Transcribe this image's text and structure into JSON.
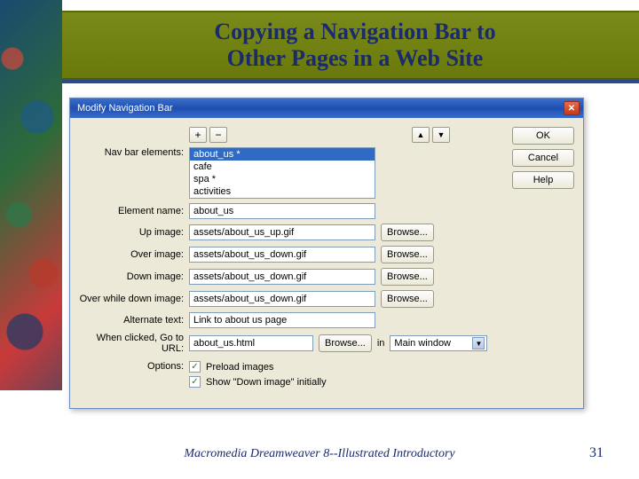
{
  "slide": {
    "title_line1": "Copying a Navigation Bar to",
    "title_line2": "Other Pages in a Web Site",
    "footer": "Macromedia Dreamweaver 8--Illustrated Introductory",
    "page_number": "31"
  },
  "dialog": {
    "title": "Modify Navigation Bar",
    "buttons": {
      "ok": "OK",
      "cancel": "Cancel",
      "help": "Help",
      "browse": "Browse...",
      "close": "✕"
    },
    "toolbar": {
      "plus": "+",
      "minus": "−",
      "up": "▲",
      "down": "▼"
    },
    "labels": {
      "nav_bar_elements": "Nav bar elements:",
      "element_name": "Element name:",
      "up_image": "Up image:",
      "over_image": "Over image:",
      "down_image": "Down image:",
      "over_while_down": "Over while down image:",
      "alternate_text": "Alternate text:",
      "goto_url": "When clicked, Go to URL:",
      "in": "in",
      "options": "Options:"
    },
    "list_items": [
      "about_us *",
      "cafe",
      "spa *",
      "activities"
    ],
    "list_selected_index": 0,
    "fields": {
      "element_name": "about_us",
      "up_image": "assets/about_us_up.gif",
      "over_image": "assets/about_us_down.gif",
      "down_image": "assets/about_us_down.gif",
      "over_while_down": "assets/about_us_down.gif",
      "alternate_text": "Link to about us page",
      "goto_url": "about_us.html",
      "target_window": "Main window"
    },
    "options": {
      "preload_images": {
        "label": "Preload images",
        "checked": true
      },
      "show_down_initially": {
        "label": "Show \"Down image\" initially",
        "checked": true
      }
    }
  }
}
